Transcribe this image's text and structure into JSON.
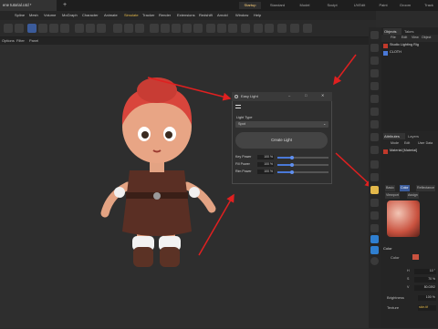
{
  "app": {
    "doc_tab": "ene tutorial.c4d * ",
    "window_title": "old *] - Main",
    "plus": "+",
    "layouts": [
      "Startup",
      "Standard",
      "Model",
      "Sculpt",
      "UVEdit",
      "Paint",
      "Groom",
      "Track"
    ]
  },
  "menu": [
    "Spline",
    "Mesh",
    "Volume",
    "MoGraph",
    "Character",
    "Animate",
    "Simulate",
    "Tracker",
    "Render",
    "Extensions",
    "Redshift",
    "Arnold",
    "Window",
    "Help"
  ],
  "viewport_menu": [
    "Options",
    "Filter",
    "Panel"
  ],
  "objects_panel": {
    "tabs": [
      "Objects",
      "Takes"
    ],
    "menu": [
      "File",
      "Edit",
      "View",
      "Object"
    ],
    "items": [
      "Studio Lighting Rig",
      "CLOTH"
    ]
  },
  "attributes_panel": {
    "tabs": [
      "Attributes",
      "Layers"
    ],
    "menu": [
      "Mode",
      "Edit",
      "User Data"
    ],
    "material_name": "Material [Material]",
    "subtabs": [
      "Basic",
      "Color",
      "Reflectance"
    ],
    "subtabs2": [
      "Viewport",
      "Assign"
    ],
    "section": "Color",
    "color_label": "Color",
    "values": [
      "H",
      "S",
      "V"
    ],
    "value_nums": [
      "10 °",
      "70 %",
      "80.0392"
    ],
    "brightness_label": "Brightness",
    "brightness_value": "100 %",
    "texture_label": "Texture",
    "texture_value": "skin.tif"
  },
  "dialog": {
    "title": "Easy Light",
    "light_type_label": "Light Type",
    "light_type_value": "Spot",
    "create_button": "Create Light",
    "sliders": [
      {
        "label": "Key Power",
        "value_text": "100 %",
        "value": 0.28
      },
      {
        "label": "Fill Power",
        "value_text": "100 %",
        "value": 0.28
      },
      {
        "label": "Rim Power",
        "value_text": "100 %",
        "value": 0.28
      }
    ]
  },
  "colors": {
    "accent_blue": "#4a79d8",
    "highlight_yellow": "#e3b84a",
    "arrow_red": "#e02020",
    "character_hair": "#d9453c",
    "character_skin": "#e8a585",
    "character_dress": "#5a2f24"
  }
}
